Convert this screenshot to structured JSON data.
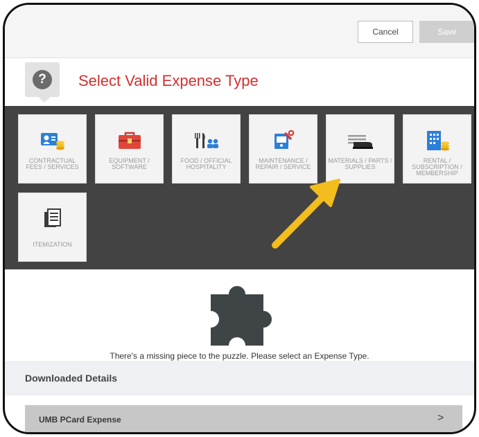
{
  "toolbar": {
    "cancel_label": "Cancel",
    "save_label": "Save"
  },
  "header": {
    "help_glyph": "?",
    "title": "Select Valid Expense Type"
  },
  "expense_types": [
    {
      "label": "CONTRACTUAL FEES / SERVICES",
      "icon": "id-card-coins-icon"
    },
    {
      "label": "EQUIPMENT / SOFTWARE",
      "icon": "toolbox-icon"
    },
    {
      "label": "FOOD / OFFICIAL HOSPITALITY",
      "icon": "utensils-people-icon"
    },
    {
      "label": "MAINTENANCE / REPAIR / SERVICE",
      "icon": "repair-tools-icon"
    },
    {
      "label": "MATERIALS / PARTS / SUPPLIES",
      "icon": "stapler-paper-icon"
    },
    {
      "label": "RENTAL / SUBSCRIPTION / MEMBERSHIP",
      "icon": "building-coins-icon"
    },
    {
      "label": "ITEMIZATION",
      "icon": "itemized-documents-icon"
    }
  ],
  "empty_state": {
    "icon": "puzzle-piece-icon",
    "message": "There's a missing piece to the puzzle. Please select an Expense Type."
  },
  "downloaded": {
    "title": "Downloaded Details",
    "item": "UMB PCard Expense",
    "chevron": ">"
  },
  "colors": {
    "title_red": "#d0302f",
    "grid_bg": "#434343",
    "arrow": "#f2bd1d"
  }
}
